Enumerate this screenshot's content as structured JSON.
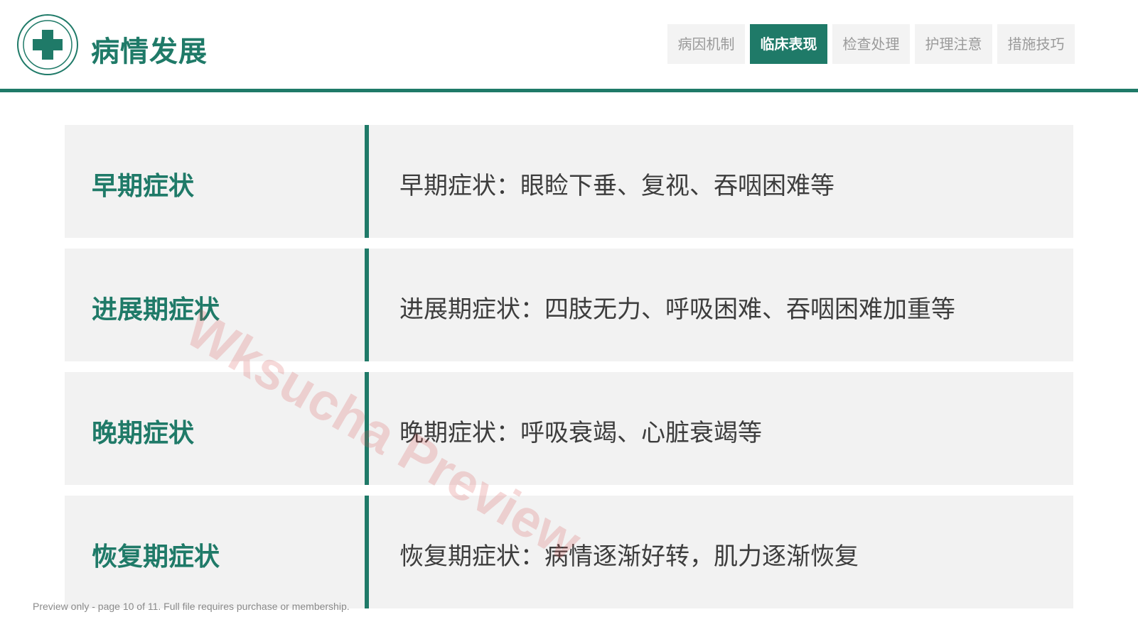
{
  "header": {
    "logo_icon": "medical-cross-icon",
    "title": "病情发展"
  },
  "tabs": [
    {
      "label": "病因机制",
      "active": false
    },
    {
      "label": "临床表现",
      "active": true
    },
    {
      "label": "检查处理",
      "active": false
    },
    {
      "label": "护理注意",
      "active": false
    },
    {
      "label": "措施技巧",
      "active": false
    }
  ],
  "rows": [
    {
      "label": "早期症状",
      "text": "早期症状：眼睑下垂、复视、吞咽困难等"
    },
    {
      "label": "进展期症状",
      "text": "进展期症状：四肢无力、呼吸困难、吞咽困难加重等"
    },
    {
      "label": "晚期症状",
      "text": "晚期症状：呼吸衰竭、心脏衰竭等"
    },
    {
      "label": "恢复期症状",
      "text": "恢复期症状：病情逐渐好转，肌力逐渐恢复"
    }
  ],
  "watermark": "Wksucha Preview",
  "footer_note": "Preview only - page 10 of 11. Full file requires purchase or membership.",
  "colors": {
    "accent": "#1f7a68",
    "row_background": "#f2f2f2",
    "tab_background": "#f3f3f3",
    "tab_text": "#9a9a9a",
    "body_text": "#3d3d3d",
    "watermark": "#d85050"
  }
}
